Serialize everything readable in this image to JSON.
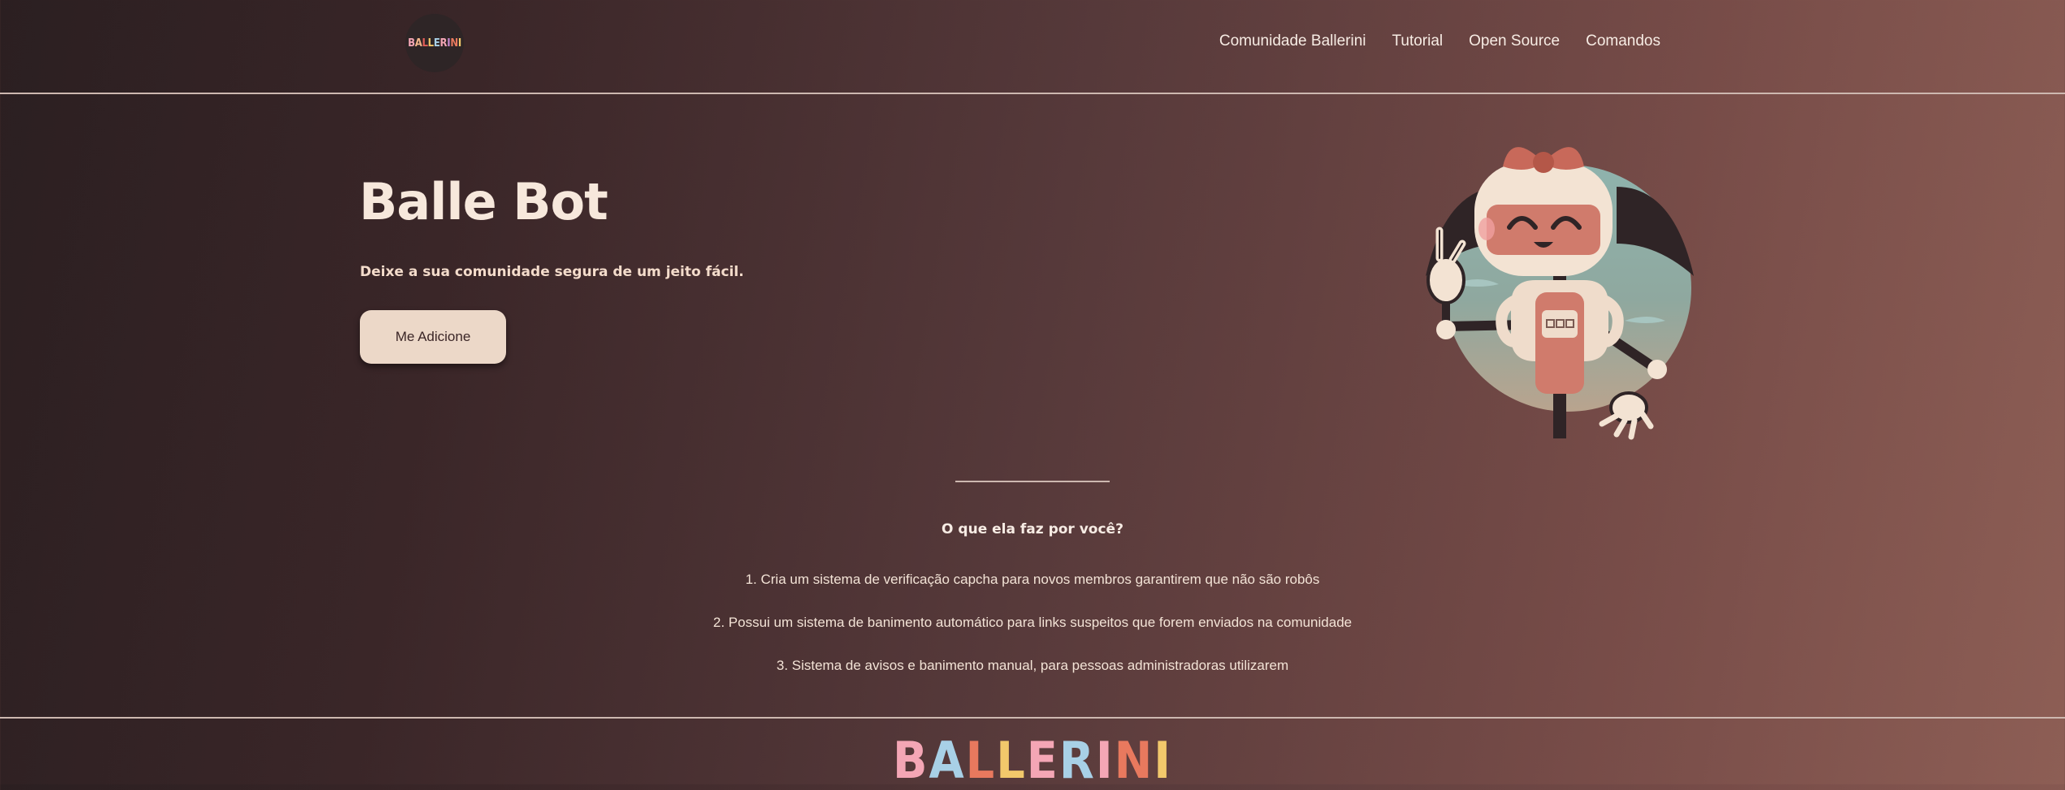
{
  "brand": {
    "logo_letters": [
      "B",
      "A",
      "L",
      "L",
      "E",
      "R",
      "I",
      "N",
      "I"
    ],
    "logo_colors": [
      "#f4a6b5",
      "#f3b78b",
      "#e45f58",
      "#f2c86b",
      "#a8d0e6",
      "#f4a6b5",
      "#c98bd1",
      "#e8795e",
      "#f2c86b"
    ]
  },
  "nav": {
    "items": [
      {
        "label": "Comunidade Ballerini"
      },
      {
        "label": "Tutorial"
      },
      {
        "label": "Open Source"
      },
      {
        "label": "Comandos"
      }
    ]
  },
  "hero": {
    "title": "Balle Bot",
    "subtitle": "Deixe a sua comunidade segura de um jeito fácil.",
    "cta_label": "Me Adicione"
  },
  "features": {
    "title": "O que ela faz por você?",
    "items": [
      "1. Cria um sistema de verificação capcha para novos membros garantirem que não são robôs",
      "2. Possui um sistema de banimento automático para links suspeitos que forem enviados na comunidade",
      "3. Sistema de avisos e banimento manual, para pessoas administradoras utilizarem"
    ]
  },
  "footer": {
    "wordmark_letters": [
      "B",
      "A",
      "L",
      "L",
      "E",
      "R",
      "I",
      "N",
      "I"
    ],
    "wordmark_colors": [
      "#f4a6b5",
      "#a8d0e6",
      "#e8795e",
      "#f2c86b",
      "#f4a6b5",
      "#a8d0e6",
      "#f4a6b5",
      "#e8795e",
      "#f2c86b"
    ]
  },
  "colors": {
    "accent_button": "#ecd8c8",
    "text_light": "#f7ece4"
  }
}
